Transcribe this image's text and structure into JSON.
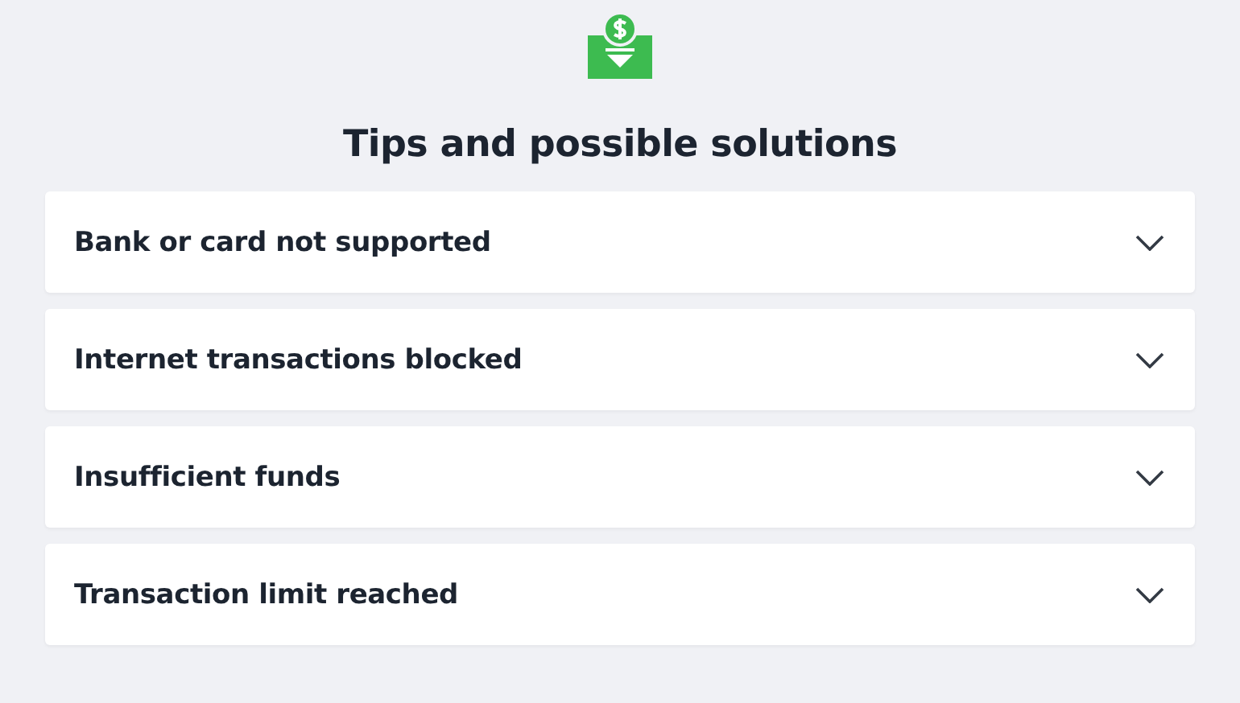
{
  "title": "Tips and possible solutions",
  "items": [
    {
      "label": "Bank or card not supported",
      "expanded": false
    },
    {
      "label": "Internet transactions blocked",
      "expanded": false
    },
    {
      "label": "Insufficient funds",
      "expanded": false
    },
    {
      "label": "Transaction limit reached",
      "expanded": false
    }
  ]
}
